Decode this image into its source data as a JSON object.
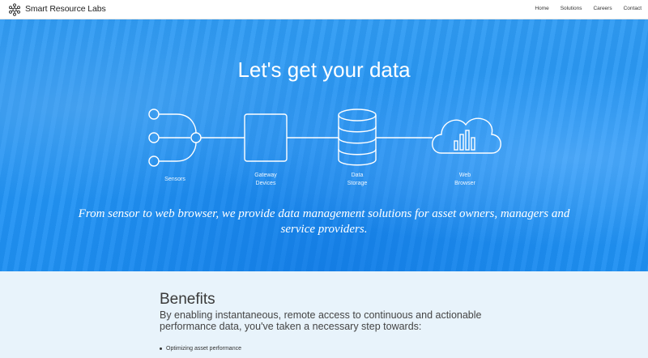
{
  "header": {
    "brand": "Smart Resource Labs",
    "logo_icon": "hexagon-network-logo",
    "nav": [
      "Home",
      "Solutions",
      "Careers",
      "Contact"
    ]
  },
  "hero": {
    "title": "Let's get your data",
    "stages": [
      {
        "label": "Sensors",
        "icon": "sensors-icon"
      },
      {
        "label": "Gateway\nDevices",
        "icon": "gateway-device-icon"
      },
      {
        "label": "Data\nStorage",
        "icon": "database-icon"
      },
      {
        "label": "Web\nBrowser",
        "icon": "cloud-chart-icon"
      }
    ],
    "tagline": "From sensor to web browser, we provide data management solutions for asset owners, managers and service providers."
  },
  "benefits": {
    "title": "Benefits",
    "intro": "By enabling instantaneous, remote access to continuous and actionable performance data, you've taken a necessary step towards:",
    "items": [
      "Optimizing asset performance"
    ]
  },
  "colors": {
    "hero_blue": "#2596f5",
    "benefits_bg": "#e8f3fb"
  }
}
